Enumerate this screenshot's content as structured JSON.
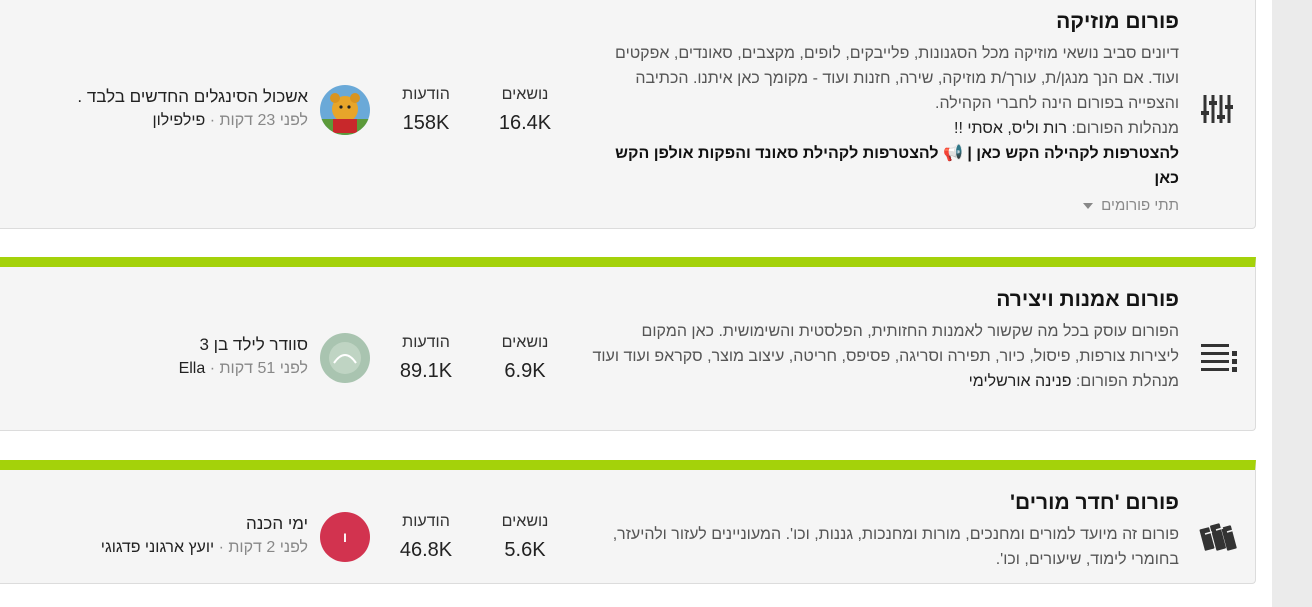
{
  "forums": [
    {
      "title": "פורום מוזיקה",
      "description": "דיונים סביב נושאי מוזיקה מכל הסגנונות, פלייבקים, לופים, מקצבים, סאונדים, אפקטים ועוד. אם הנך מנגן/ת, עורך/ת מוזיקה, שירה, חזנות ועוד - מקומך כאן איתנו. הכתיבה והצפייה בפורום הינה לחברי הקהילה.",
      "moderators_label": "מנהלות הפורום:",
      "moderators": "רות וליס, אסתי !!",
      "links": "להצטרפות לקהילה הקש כאן | 📢 להצטרפות לקהילת סאונד והפקות אולפן הקש כאן",
      "subforums_label": "תתי פורומים",
      "topics_label": "נושאים",
      "topics": "16.4K",
      "posts_label": "הודעות",
      "posts": "158K",
      "last_title": "אשכול הסינגלים החדשים בלבד .",
      "last_time": "לפני 23 דקות",
      "last_user": "פילפילון",
      "icon": "sliders-icon"
    },
    {
      "title": "פורום אמנות ויצירה",
      "description": "הפורום עוסק בכל מה שקשור לאמנות החזותית, הפלסטית והשימושית. כאן המקום ליצירות צורפות, פיסול, כיור, תפירה וסריגה, פסיפס, חריטה, עיצוב מוצר, סקראפ ועוד ועוד",
      "moderators_label": "מנהלת הפורום:",
      "moderators": "פנינה אורשלימי",
      "topics_label": "נושאים",
      "topics": "6.9K",
      "posts_label": "הודעות",
      "posts": "89.1K",
      "last_title": "סוודר לילד בן 3",
      "last_time": "לפני 51 דקות",
      "last_user": "Ella",
      "icon": "list-icon"
    },
    {
      "title": "פורום 'חדר מורים'",
      "description": "פורום זה מיועד למורים ומחנכים, מורות ומחנכות, גננות, וכו'. המעוניינים לעזור ולהיעזר, בחומרי לימוד, שיעורים, וכו'.",
      "topics_label": "נושאים",
      "topics": "5.6K",
      "posts_label": "הודעות",
      "posts": "46.8K",
      "last_title": "ימי הכנה",
      "last_time": "לפני 2 דקות",
      "last_user": "יועץ ארגוני פדגוגי",
      "avatar_letter": "ו",
      "icon": "books-icon"
    }
  ],
  "colors": {
    "accent_bar": "#a4d20a",
    "avatar_red": "#d2334f"
  }
}
